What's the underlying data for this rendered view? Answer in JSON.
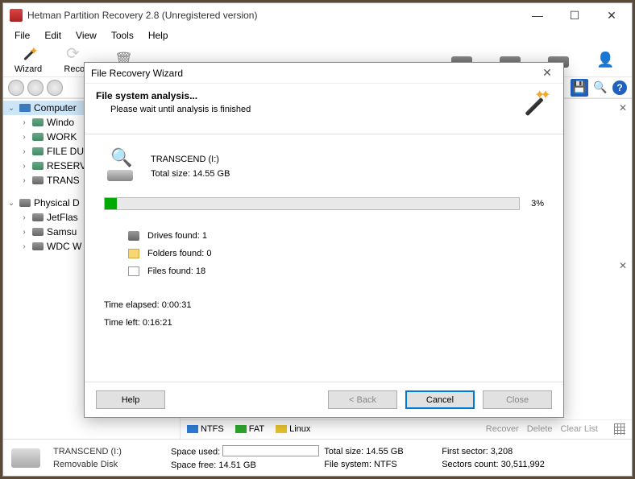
{
  "window": {
    "title": "Hetman Partition Recovery 2.8 (Unregistered version)"
  },
  "menu": {
    "file": "File",
    "edit": "Edit",
    "view": "View",
    "tools": "Tools",
    "help": "Help"
  },
  "toolbar": {
    "wizard": "Wizard",
    "recover": "Recov"
  },
  "tree": {
    "computer": "Computer",
    "items1": [
      "Windo",
      "WORK",
      "FILE DU",
      "RESERV",
      "TRANS"
    ],
    "physical": "Physical D",
    "items2": [
      "JetFlas",
      "Samsu",
      "WDC W"
    ]
  },
  "legend": {
    "ntfs": "NTFS",
    "fat": "FAT",
    "linux": "Linux",
    "recover": "Recover",
    "delete": "Delete",
    "clear": "Clear List"
  },
  "status": {
    "name": "TRANSCEND (I:)",
    "type": "Removable Disk",
    "used_lbl": "Space used:",
    "free_lbl": "Space free:",
    "free": "14.51 GB",
    "total_lbl": "Total size:",
    "total": "14.55 GB",
    "fs_lbl": "File system:",
    "fs": "NTFS",
    "first_lbl": "First sector:",
    "first": "3,208",
    "sectors_lbl": "Sectors count:",
    "sectors": "30,511,992"
  },
  "dialog": {
    "title": "File Recovery Wizard",
    "heading": "File system analysis...",
    "sub": "Please wait until analysis is finished",
    "drive": "TRANSCEND (I:)",
    "totalsize": "Total size: 14.55 GB",
    "progress_pct": "3%",
    "progress_width": "3%",
    "drives": "Drives found: 1",
    "folders": "Folders found: 0",
    "files": "Files found: 18",
    "elapsed": "Time elapsed: 0:00:31",
    "left": "Time left: 0:16:21",
    "help": "Help",
    "back": "< Back",
    "cancel": "Cancel",
    "close": "Close"
  }
}
